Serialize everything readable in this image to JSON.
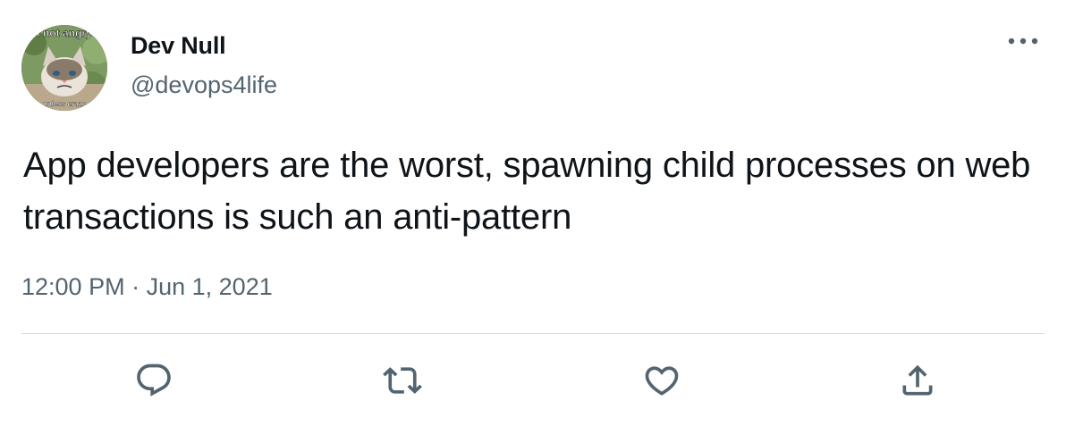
{
  "author": {
    "display_name": "Dev Null",
    "handle": "@devops4life",
    "avatar_caption_top": "I not angry",
    "avatar_caption_bottom": "unless crazy"
  },
  "tweet": {
    "text": "App developers are the worst, spawning child processes on web transactions is such an anti-pattern",
    "time": "12:00 PM",
    "separator": "·",
    "date": "Jun 1, 2021"
  },
  "actions": [
    {
      "icon": "reply-icon"
    },
    {
      "icon": "retweet-icon"
    },
    {
      "icon": "like-icon"
    },
    {
      "icon": "share-icon"
    }
  ],
  "colors": {
    "text_primary": "#0f1419",
    "text_secondary": "#536471",
    "divider": "#cfd9de"
  }
}
